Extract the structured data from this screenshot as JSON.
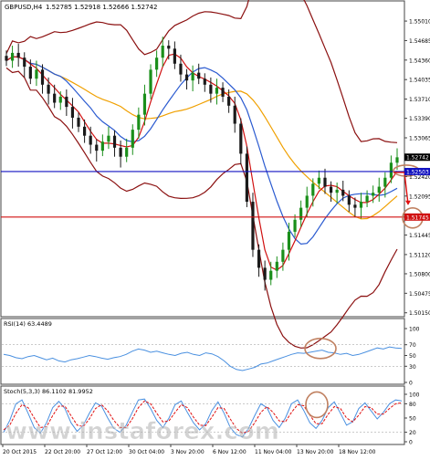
{
  "header": {
    "symbol_text": "GBPUSD,H4",
    "ohlc_text": "1.52785 1.52918 1.52666 1.52742"
  },
  "colors": {
    "bull_candle": "#1a8f1a",
    "bear_candle": "#1a1a1a",
    "bollinger": "#8b1010",
    "ma_fast": "#d01010",
    "ma_mid": "#2a5ad0",
    "ma_slow": "#f0a000",
    "support_line": "#1010c0",
    "resistance_line": "#d01010",
    "annotation": "#c08060",
    "rsi_line": "#4a90e0",
    "stoch_main": "#4a90e0",
    "stoch_signal": "#e01010",
    "current_price_bg": "#1010c0",
    "level_bg": "#d01010"
  },
  "chart_data": [
    {
      "type": "line",
      "panel": "main",
      "title": "GBPUSD,H4",
      "ylim": [
        1.501,
        1.553
      ],
      "y_ticks": [
        "1.55010",
        "1.54685",
        "1.54360",
        "1.54035",
        "1.53710",
        "1.53390",
        "1.53065",
        "1.52742",
        "1.52420",
        "1.52095",
        "1.51770",
        "1.51445",
        "1.51120",
        "1.50800",
        "1.50475",
        "1.50150"
      ],
      "x_ticks": [
        "20 Oct 2015",
        "22 Oct 20:00",
        "27 Oct 12:00",
        "30 Oct 04:00",
        "3 Nov 20:00",
        "6 Nov 12:00",
        "11 Nov 04:00",
        "13 Nov 20:00",
        "18 Nov 12:00"
      ],
      "current_price": 1.52742,
      "horizontal_levels": [
        {
          "label": "1.52503",
          "value": 1.52503
        },
        {
          "label": "1.51745",
          "value": 1.51745
        }
      ],
      "close_series": [
        1.5435,
        1.5448,
        1.544,
        1.5425,
        1.5405,
        1.542,
        1.5395,
        1.538,
        1.5365,
        1.5375,
        1.5358,
        1.534,
        1.5325,
        1.531,
        1.5295,
        1.5285,
        1.53,
        1.531,
        1.529,
        1.5275,
        1.529,
        1.532,
        1.5345,
        1.538,
        1.542,
        1.544,
        1.546,
        1.5455,
        1.543,
        1.5412,
        1.5402,
        1.5415,
        1.5405,
        1.5395,
        1.538,
        1.539,
        1.5375,
        1.536,
        1.533,
        1.528,
        1.52,
        1.512,
        1.509,
        1.507,
        1.5085,
        1.51,
        1.512,
        1.515,
        1.517,
        1.519,
        1.521,
        1.523,
        1.524,
        1.5225,
        1.5215,
        1.522,
        1.521,
        1.5195,
        1.519,
        1.52,
        1.521,
        1.5215,
        1.5225,
        1.524,
        1.5265,
        1.5274
      ]
    },
    {
      "type": "line",
      "panel": "rsi",
      "title": "RSI(14) 63.4489",
      "ylim": [
        0,
        100
      ],
      "y_ticks": [
        "100",
        "70",
        "50",
        "30",
        "0"
      ],
      "series": [
        {
          "name": "RSI(14)",
          "values": [
            52,
            50,
            46,
            44,
            48,
            50,
            46,
            42,
            45,
            40,
            38,
            42,
            44,
            47,
            50,
            48,
            45,
            43,
            46,
            48,
            52,
            58,
            62,
            60,
            56,
            58,
            55,
            52,
            50,
            54,
            56,
            52,
            50,
            55,
            53,
            48,
            40,
            30,
            24,
            22,
            25,
            28,
            34,
            36,
            40,
            44,
            48,
            52,
            55,
            54,
            56,
            58,
            60,
            56,
            55,
            52,
            54,
            50,
            52,
            56,
            60,
            64,
            62,
            66,
            64,
            63
          ]
        }
      ]
    },
    {
      "type": "line",
      "panel": "stochastic",
      "title": "Stoch(5,3,3) 86.1102 81.9952",
      "ylim": [
        0,
        100
      ],
      "y_ticks": [
        "100",
        "80",
        "50",
        "20",
        "0"
      ],
      "series": [
        {
          "name": "%K",
          "values": [
            20,
            45,
            80,
            88,
            60,
            30,
            18,
            40,
            72,
            85,
            70,
            40,
            22,
            35,
            60,
            82,
            75,
            50,
            28,
            20,
            35,
            62,
            88,
            90,
            70,
            45,
            30,
            50,
            78,
            86,
            62,
            40,
            25,
            38,
            66,
            84,
            60,
            30,
            15,
            10,
            28,
            55,
            80,
            72,
            45,
            30,
            50,
            80,
            88,
            66,
            40,
            28,
            45,
            72,
            84,
            60,
            35,
            42,
            70,
            82,
            65,
            48,
            62,
            80,
            88,
            86
          ]
        },
        {
          "name": "%D",
          "values": [
            25,
            35,
            60,
            78,
            72,
            50,
            30,
            32,
            55,
            75,
            75,
            55,
            35,
            32,
            48,
            70,
            78,
            65,
            45,
            30,
            30,
            48,
            72,
            86,
            80,
            60,
            42,
            44,
            62,
            78,
            72,
            52,
            35,
            34,
            52,
            72,
            70,
            48,
            28,
            18,
            22,
            40,
            62,
            74,
            62,
            44,
            42,
            62,
            78,
            76,
            56,
            38,
            38,
            58,
            74,
            70,
            50,
            42,
            56,
            74,
            72,
            58,
            58,
            70,
            80,
            82
          ]
        }
      ]
    }
  ],
  "annotations": {
    "watermark_text": "www.instaforex.com"
  }
}
